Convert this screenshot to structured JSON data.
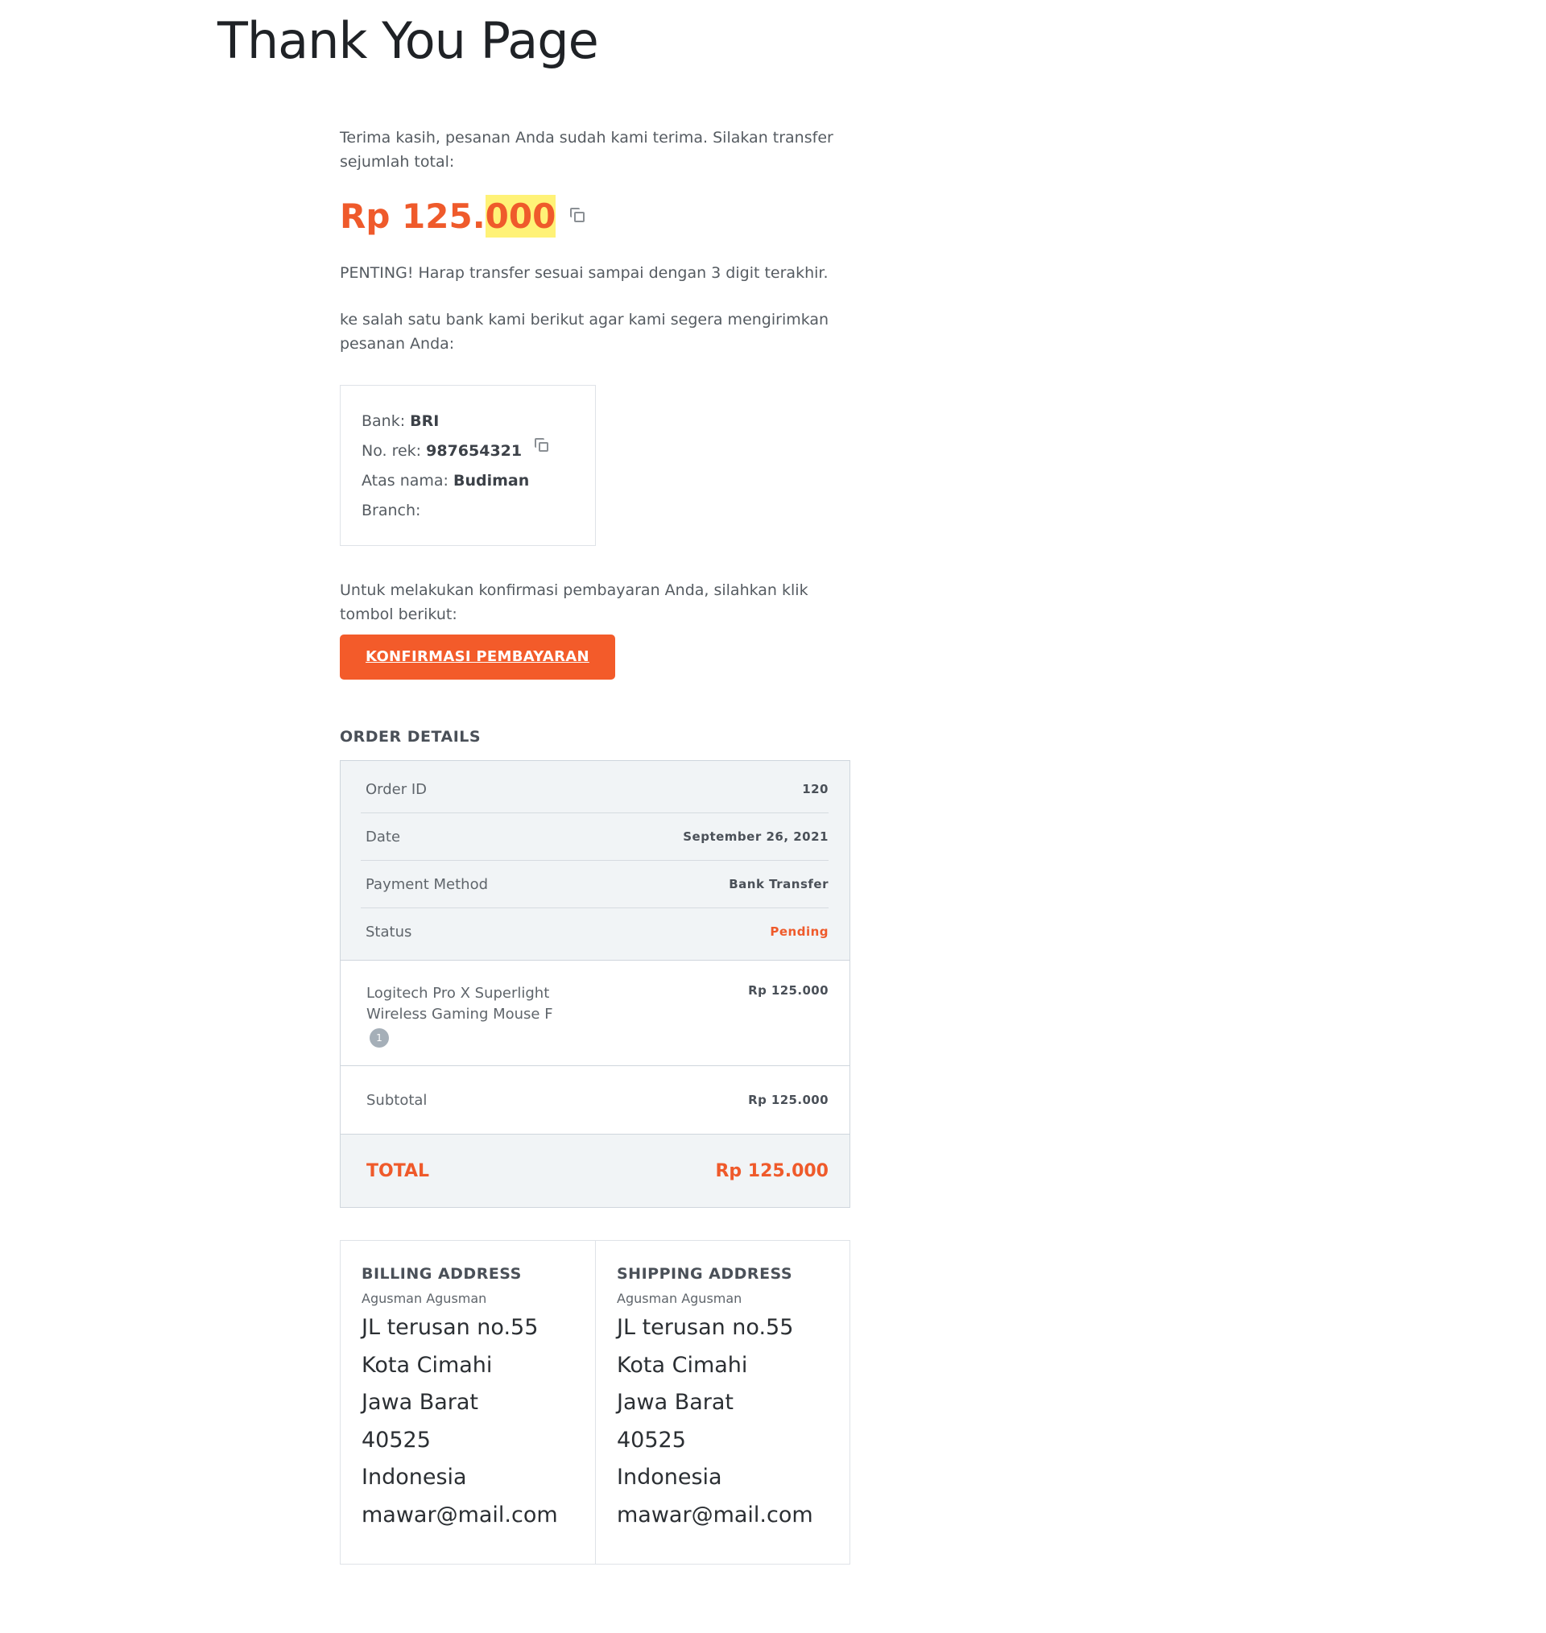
{
  "page": {
    "title": "Thank You Page"
  },
  "intro": "Terima kasih, pesanan Anda sudah kami terima. Silakan transfer sejumlah total:",
  "amount": {
    "prefix": "Rp 125.",
    "highlight": "000"
  },
  "important": "PENTING! Harap transfer sesuai sampai dengan 3 digit terakhir.",
  "bank_intro": "ke salah satu bank kami berikut agar kami segera mengirimkan pesanan Anda:",
  "bank": {
    "bank_label": "Bank:",
    "bank_value": "BRI",
    "account_label": "No. rek:",
    "account_value": "987654321",
    "name_label": "Atas nama:",
    "name_value": "Budiman",
    "branch_label": "Branch:"
  },
  "confirm": {
    "text": "Untuk melakukan konfirmasi pembayaran Anda, silahkan klik tombol berikut:",
    "button": "KONFIRMASI PEMBAYARAN"
  },
  "order": {
    "heading": "ORDER DETAILS",
    "order_id_label": "Order ID",
    "order_id": "120",
    "date_label": "Date",
    "date": "September 26, 2021",
    "payment_label": "Payment Method",
    "payment": "Bank Transfer",
    "status_label": "Status",
    "status": "Pending",
    "item_name": "Logitech Pro X Superlight Wireless Gaming Mouse F",
    "item_qty": "1",
    "item_price": "Rp 125.000",
    "subtotal_label": "Subtotal",
    "subtotal": "Rp 125.000",
    "total_label": "TOTAL",
    "total": "Rp 125.000"
  },
  "billing": {
    "heading": "BILLING ADDRESS",
    "name": "Agusman Agusman",
    "street": "JL terusan no.55",
    "city": "Kota Cimahi",
    "province": "Jawa Barat",
    "postcode": "40525",
    "country": "Indonesia",
    "email": "mawar@mail.com"
  },
  "shipping": {
    "heading": "SHIPPING ADDRESS",
    "name": "Agusman Agusman",
    "street": "JL terusan no.55",
    "city": "Kota Cimahi",
    "province": "Jawa Barat",
    "postcode": "40525",
    "country": "Indonesia",
    "email": "mawar@mail.com"
  },
  "colors": {
    "accent": "#ef5a2b",
    "button": "#f35b2a",
    "highlight": "#fff277",
    "panel": "#f1f4f6"
  }
}
